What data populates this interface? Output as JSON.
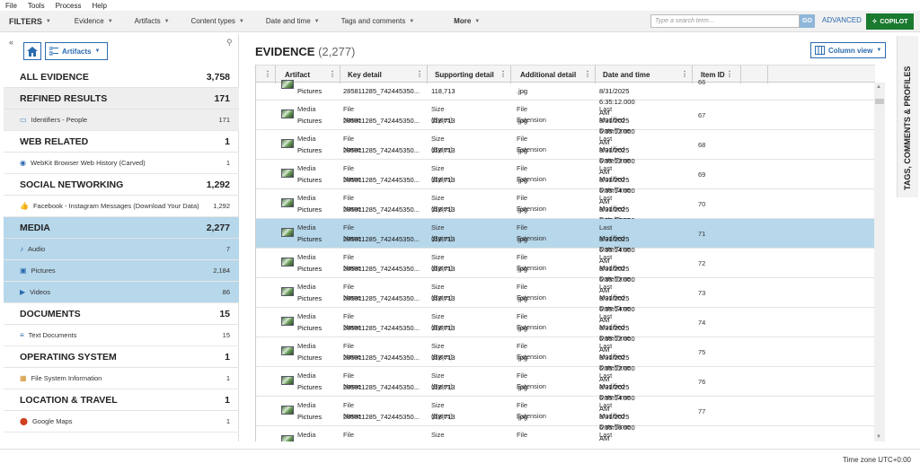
{
  "menu": [
    "File",
    "Tools",
    "Process",
    "Help"
  ],
  "filterbar": {
    "filters_label": "FILTERS",
    "items": [
      "Evidence",
      "Artifacts",
      "Content types",
      "Date and time",
      "Tags and comments",
      "More"
    ],
    "search_placeholder": "Type a search term...",
    "go_label": "GO",
    "advanced_label": "ADVANCED",
    "copilot_label": "COPILOT"
  },
  "left": {
    "artifacts_dropdown": "Artifacts",
    "categories": [
      {
        "name": "ALL EVIDENCE",
        "count": "3,758",
        "subs": []
      },
      {
        "name": "REFINED RESULTS",
        "count": "171",
        "subs": [
          {
            "label": "Identifiers - People",
            "count": "171",
            "icon": "id-card-icon",
            "color": "#2a6ab0"
          }
        ]
      },
      {
        "name": "WEB RELATED",
        "count": "1",
        "subs": [
          {
            "label": "WebKit Browser Web History (Carved)",
            "count": "1",
            "icon": "globe-icon",
            "color": "#2a6ab0"
          }
        ]
      },
      {
        "name": "SOCIAL NETWORKING",
        "count": "1,292",
        "subs": [
          {
            "label": "Facebook - Instagram Messages (Download Your Data)",
            "count": "1,292",
            "icon": "thumbs-up-icon",
            "color": "#888"
          }
        ]
      },
      {
        "name": "MEDIA",
        "count": "2,277",
        "subs": [
          {
            "label": "Audio",
            "count": "7",
            "icon": "audio-icon",
            "color": "#2a6ab0"
          },
          {
            "label": "Pictures",
            "count": "2,184",
            "icon": "picture-icon",
            "color": "#2a6ab0"
          },
          {
            "label": "Videos",
            "count": "86",
            "icon": "video-icon",
            "color": "#2a6ab0"
          }
        ]
      },
      {
        "name": "DOCUMENTS",
        "count": "15",
        "subs": [
          {
            "label": "Text Documents",
            "count": "15",
            "icon": "text-doc-icon",
            "color": "#2a6ab0"
          }
        ]
      },
      {
        "name": "OPERATING SYSTEM",
        "count": "1",
        "subs": [
          {
            "label": "File System Information",
            "count": "1",
            "icon": "filesystem-icon",
            "color": "#d08a20"
          }
        ]
      },
      {
        "name": "LOCATION & TRAVEL",
        "count": "1",
        "subs": [
          {
            "label": "Google Maps",
            "count": "1",
            "icon": "map-pin-icon",
            "color": "#d04020"
          }
        ]
      }
    ]
  },
  "main": {
    "title": "EVIDENCE",
    "count": "(2,277)",
    "column_view_label": "Column view",
    "columns": [
      "Artifact",
      "Key detail",
      "Supporting detail",
      "Additional detail",
      "Date and time",
      "Item ID"
    ],
    "rows": [
      {
        "artifact_a": "",
        "artifact_b": "Pictures",
        "key_a": "",
        "key_b": "285811285_742445350...",
        "sup_a": "",
        "sup_b": "118,713",
        "add_a": "",
        "add_b": ".jpg",
        "dt_a": "",
        "dt_b": "8/31/2025 6:35:12.000 AM",
        "id": "66",
        "selected": false,
        "partial": true
      },
      {
        "artifact_a": "Media",
        "artifact_b": "Pictures",
        "key_a": "File Name",
        "key_b": "285811285_742445350...",
        "sup_a": "Size (Bytes)",
        "sup_b": "118,713",
        "add_a": "File Extension",
        "add_b": ".jpg",
        "dt_a": "Last Modified Date/Time",
        "dt_b": "8/31/2025 6:35:12.000 AM",
        "id": "67",
        "selected": false
      },
      {
        "artifact_a": "Media",
        "artifact_b": "Pictures",
        "key_a": "File Name",
        "key_b": "285811285_742445350...",
        "sup_a": "Size (Bytes)",
        "sup_b": "118,713",
        "add_a": "File Extension",
        "add_b": ".jpg",
        "dt_a": "Last Modified Date/Time",
        "dt_b": "8/31/2025 6:35:12.000 AM",
        "id": "68",
        "selected": false
      },
      {
        "artifact_a": "Media",
        "artifact_b": "Pictures",
        "key_a": "File Name",
        "key_b": "285811285_742445350...",
        "sup_a": "Size (Bytes)",
        "sup_b": "118,713",
        "add_a": "File Extension",
        "add_b": ".jpg",
        "dt_a": "Last Modified Date/Time",
        "dt_b": "8/31/2025 6:35:14.000 AM",
        "id": "69",
        "selected": false
      },
      {
        "artifact_a": "Media",
        "artifact_b": "Pictures",
        "key_a": "File Name",
        "key_b": "285811285_742445350...",
        "sup_a": "Size (Bytes)",
        "sup_b": "118,713",
        "add_a": "File Extension",
        "add_b": ".jpg",
        "dt_a": "Last Modified Date/Time",
        "dt_b": "8/31/2025 6:35:12.000 AM",
        "id": "70",
        "selected": false
      },
      {
        "artifact_a": "Media",
        "artifact_b": "Pictures",
        "key_a": "File Name",
        "key_b": "285811285_742445350...",
        "sup_a": "Size (Bytes)",
        "sup_b": "118,713",
        "add_a": "File Extension",
        "add_b": ".jpg",
        "dt_a": "Last Modified Date/Time",
        "dt_b": "8/31/2025 6:35:14.000 AM",
        "id": "71",
        "selected": true
      },
      {
        "artifact_a": "Media",
        "artifact_b": "Pictures",
        "key_a": "File Name",
        "key_b": "285811285_742445350...",
        "sup_a": "Size (Bytes)",
        "sup_b": "118,713",
        "add_a": "File Extension",
        "add_b": ".jpg",
        "dt_a": "Last Modified Date/Time",
        "dt_b": "8/31/2025 6:35:12.000 AM",
        "id": "72",
        "selected": false
      },
      {
        "artifact_a": "Media",
        "artifact_b": "Pictures",
        "key_a": "File Name",
        "key_b": "285811285_742445350...",
        "sup_a": "Size (Bytes)",
        "sup_b": "118,713",
        "add_a": "File Extension",
        "add_b": ".jpg",
        "dt_a": "Last Modified Date/Time",
        "dt_b": "8/31/2025 6:35:14.000 AM",
        "id": "73",
        "selected": false
      },
      {
        "artifact_a": "Media",
        "artifact_b": "Pictures",
        "key_a": "File Name",
        "key_b": "285811285_742445350...",
        "sup_a": "Size (Bytes)",
        "sup_b": "118,713",
        "add_a": "File Extension",
        "add_b": ".jpg",
        "dt_a": "Last Modified Date/Time",
        "dt_b": "8/31/2025 6:35:12.000 AM",
        "id": "74",
        "selected": false
      },
      {
        "artifact_a": "Media",
        "artifact_b": "Pictures",
        "key_a": "File Name",
        "key_b": "285811285_742445350...",
        "sup_a": "Size (Bytes)",
        "sup_b": "118,713",
        "add_a": "File Extension",
        "add_b": ".jpg",
        "dt_a": "Last Modified Date/Time",
        "dt_b": "8/31/2025 6:35:12.000 AM",
        "id": "75",
        "selected": false
      },
      {
        "artifact_a": "Media",
        "artifact_b": "Pictures",
        "key_a": "File Name",
        "key_b": "285811285_742445350...",
        "sup_a": "Size (Bytes)",
        "sup_b": "118,713",
        "add_a": "File Extension",
        "add_b": ".jpg",
        "dt_a": "Last Modified Date/Time",
        "dt_b": "8/31/2025 6:35:14.000 AM",
        "id": "76",
        "selected": false
      },
      {
        "artifact_a": "Media",
        "artifact_b": "Pictures",
        "key_a": "File Name",
        "key_b": "285811285_742445350...",
        "sup_a": "Size (Bytes)",
        "sup_b": "118,713",
        "add_a": "File Extension",
        "add_b": ".jpg",
        "dt_a": "Last Modified Date/Time",
        "dt_b": "8/31/2025 6:35:16.000 AM",
        "id": "77",
        "selected": false
      },
      {
        "artifact_a": "Media",
        "artifact_b": "",
        "key_a": "File Name",
        "key_b": "",
        "sup_a": "Size (Bytes)",
        "sup_b": "",
        "add_a": "File Extension",
        "add_b": "",
        "dt_a": "Last Modified Date/Time",
        "dt_b": "",
        "id": "",
        "selected": false
      }
    ]
  },
  "right_rail_label": "TAGS, COMMENTS & PROFILES",
  "status": {
    "timezone": "Time zone   UTC+0:00"
  },
  "colors": {
    "accent": "#2a6ab0",
    "selected_row": "#b7d7ea",
    "copilot": "#1a7a2f"
  }
}
